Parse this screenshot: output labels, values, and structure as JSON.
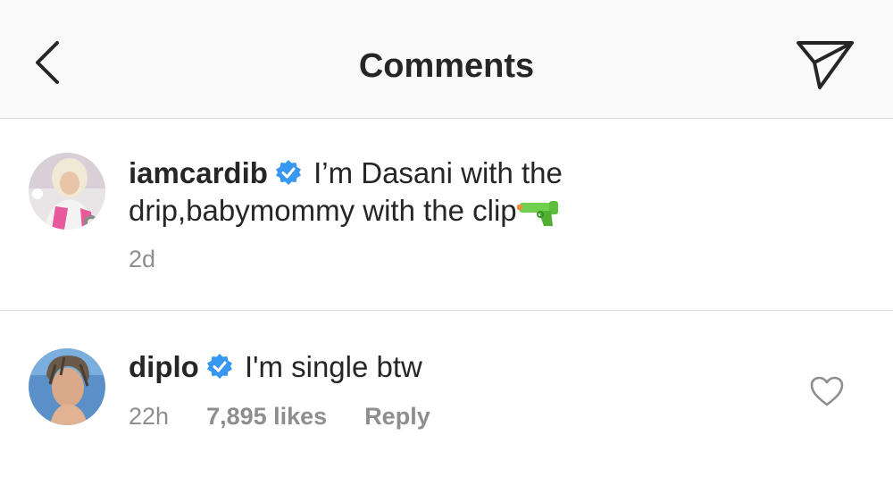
{
  "header": {
    "title": "Comments",
    "back_icon": "chevron-left-icon",
    "share_icon": "direct-send-icon"
  },
  "comments": [
    {
      "username": "iamcardib",
      "verified": true,
      "text": "I’m Dasani with the drip,babymommy with the clip",
      "emoji": "water-pistol-icon",
      "time": "2d"
    },
    {
      "username": "diplo",
      "verified": true,
      "text": "I'm single btw",
      "time": "22h",
      "likes": "7,895 likes",
      "reply_label": "Reply",
      "like_icon": "heart-outline-icon"
    }
  ],
  "colors": {
    "verified_blue": "#3897f0",
    "secondary_text": "#8e8e8e",
    "divider": "#dbdbdb",
    "header_bg": "#fafafa"
  }
}
